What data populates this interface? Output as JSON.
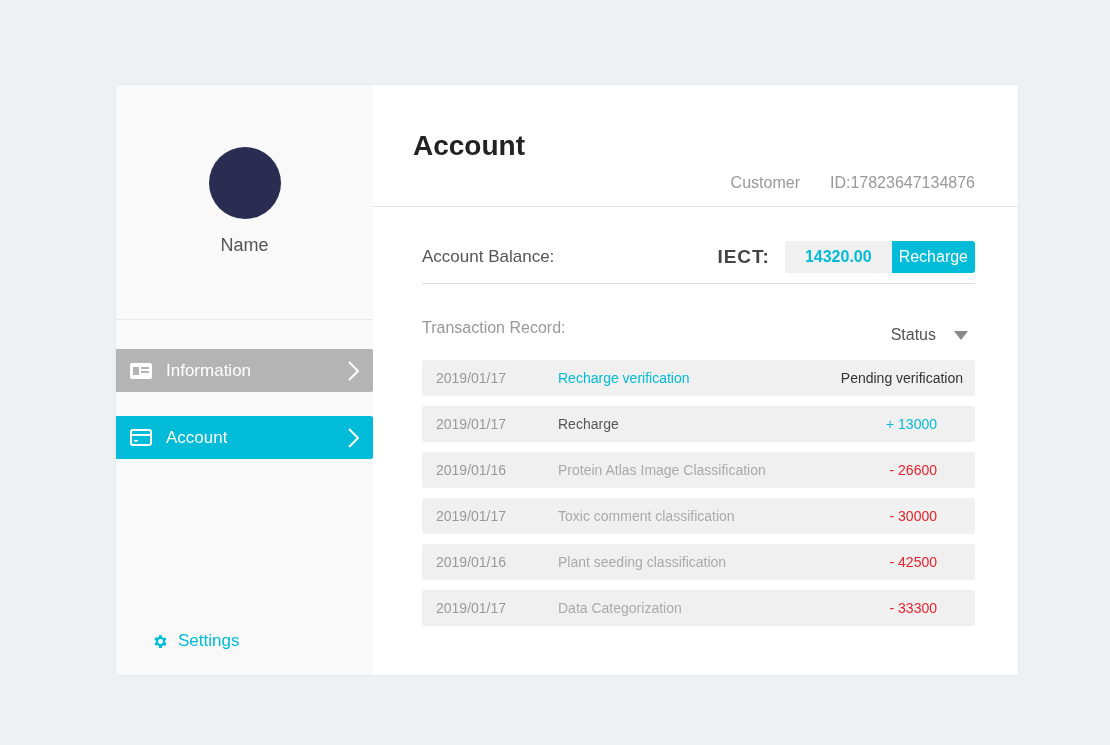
{
  "sidebar": {
    "name": "Name",
    "items": [
      {
        "label": "Information",
        "selected": false
      },
      {
        "label": "Account",
        "selected": true
      }
    ],
    "settings": "Settings"
  },
  "header": {
    "title": "Account",
    "customer": "Customer",
    "id": "ID:17823647134876"
  },
  "balance": {
    "label": "Account Balance:",
    "currency": "IECT:",
    "amount": "14320.00",
    "button": "Recharge"
  },
  "transactions": {
    "title": "Transaction Record:",
    "filter": "Status",
    "rows": [
      {
        "date": "2019/01/17",
        "description": "Recharge verification",
        "amount": "Pending verification",
        "kind": "pending"
      },
      {
        "date": "2019/01/17",
        "description": "Recharge",
        "amount": "+ 13000",
        "kind": "credit"
      },
      {
        "date": "2019/01/16",
        "description": "Protein Atlas Image Classification",
        "amount": "- 26600",
        "kind": "debit"
      },
      {
        "date": "2019/01/17",
        "description": "Toxic comment classification",
        "amount": "- 30000",
        "kind": "debit"
      },
      {
        "date": "2019/01/16",
        "description": "Plant seeding classification",
        "amount": "- 42500",
        "kind": "debit"
      },
      {
        "date": "2019/01/17",
        "description": "Data Categorization",
        "amount": "- 33300",
        "kind": "debit"
      }
    ]
  }
}
